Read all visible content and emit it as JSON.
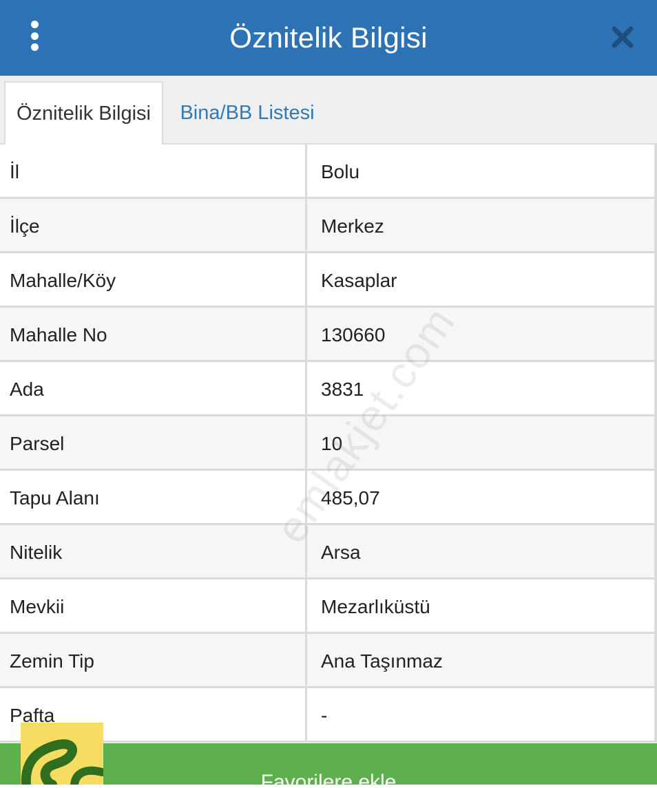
{
  "header": {
    "title": "Öznitelik Bilgisi",
    "menu_icon": "kebab-menu-icon",
    "close_icon": "close-icon",
    "background_color": "#2d72b4"
  },
  "tabs": [
    {
      "label": "Öznitelik Bilgisi",
      "active": true
    },
    {
      "label": "Bina/BB Listesi",
      "active": false
    }
  ],
  "attributes": [
    {
      "label": "İl",
      "value": "Bolu"
    },
    {
      "label": "İlçe",
      "value": "Merkez"
    },
    {
      "label": "Mahalle/Köy",
      "value": "Kasaplar"
    },
    {
      "label": "Mahalle No",
      "value": "130660"
    },
    {
      "label": "Ada",
      "value": "3831"
    },
    {
      "label": "Parsel",
      "value": "10"
    },
    {
      "label": "Tapu Alanı",
      "value": "485,07"
    },
    {
      "label": "Nitelik",
      "value": "Arsa"
    },
    {
      "label": "Mevkii",
      "value": "Mezarlıküstü"
    },
    {
      "label": "Zemin Tip",
      "value": "Ana Taşınmaz"
    },
    {
      "label": "Pafta",
      "value": "-"
    }
  ],
  "footer": {
    "button_label": "Favorilere ekle",
    "button_color": "#5eb04e"
  },
  "watermark": "emlakjet.com"
}
